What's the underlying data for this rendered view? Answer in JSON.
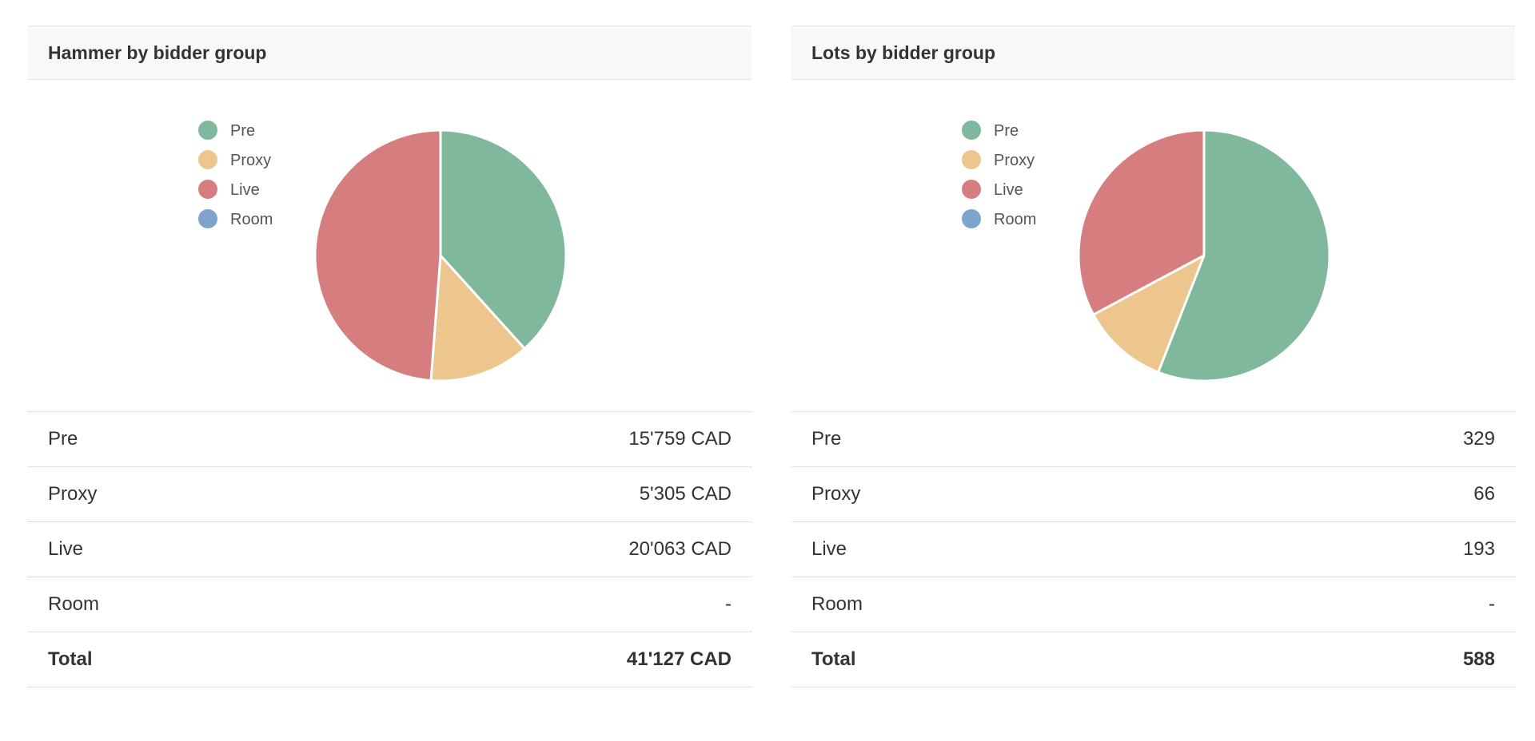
{
  "panels": [
    {
      "title": "Hammer by bidder group",
      "rows": [
        {
          "label": "Pre",
          "value": "15'759 CAD"
        },
        {
          "label": "Proxy",
          "value": "5'305 CAD"
        },
        {
          "label": "Live",
          "value": "20'063 CAD"
        },
        {
          "label": "Room",
          "value": "-"
        }
      ],
      "total": {
        "label": "Total",
        "value": "41'127 CAD"
      }
    },
    {
      "title": "Lots by bidder group",
      "rows": [
        {
          "label": "Pre",
          "value": "329"
        },
        {
          "label": "Proxy",
          "value": "66"
        },
        {
          "label": "Live",
          "value": "193"
        },
        {
          "label": "Room",
          "value": "-"
        }
      ],
      "total": {
        "label": "Total",
        "value": "588"
      }
    }
  ],
  "chart_data": [
    {
      "type": "pie",
      "title": "Hammer by bidder group",
      "legend_position": "left",
      "categories": [
        "Pre",
        "Proxy",
        "Live",
        "Room"
      ],
      "values": [
        15759,
        5305,
        20063,
        0
      ],
      "colors": [
        "#80b89d",
        "#ecc68c",
        "#d67e7f",
        "#7ea3cc"
      ]
    },
    {
      "type": "pie",
      "title": "Lots by bidder group",
      "legend_position": "left",
      "categories": [
        "Pre",
        "Proxy",
        "Live",
        "Room"
      ],
      "values": [
        329,
        66,
        193,
        0
      ],
      "colors": [
        "#80b89d",
        "#ecc68c",
        "#d67e7f",
        "#7ea3cc"
      ]
    }
  ]
}
